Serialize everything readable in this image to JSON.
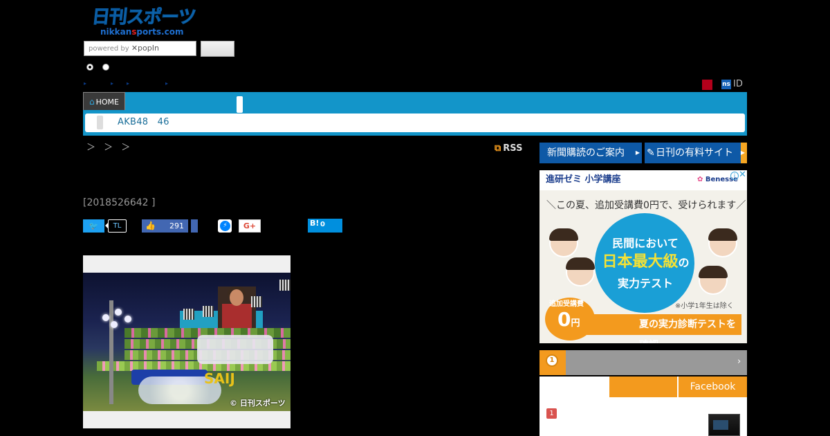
{
  "logo": {
    "jp": "日刊スポーツ",
    "en_pre": "nikkan",
    "en_s": "s",
    "en_post": "ports.com"
  },
  "search": {
    "powered_by": "powered by",
    "popin": "✕popIn",
    "button_label": ""
  },
  "nav": {
    "home": "HOME",
    "subnav_text": "AKB48　46"
  },
  "header_links": {
    "id_label": "ID",
    "ns_label": "ns"
  },
  "breadcrumb": "＞ ＞ ＞",
  "rss": "RSS",
  "article": {
    "date": "[2018526642 ]"
  },
  "share": {
    "twitter_label": "",
    "tl_label": "TL",
    "like_count": "291",
    "gplus_label": "G+",
    "hatena_label": "B!",
    "hatena_count": "0"
  },
  "photo": {
    "credit": "© 日刊スポーツ",
    "sign_text": "SAIJ"
  },
  "sidebar": {
    "subscribe_btn": "新聞購読のご案内",
    "paid_btn": "日刊の有料サイト",
    "ad": {
      "title": "進研ゼミ 小学講座",
      "brand": "Benesse",
      "slogan": "＼この夏、追加受講費0円で、受けられます／",
      "circle_l1": "民間において",
      "circle_l2": "日本最大級",
      "circle_l2_suffix": "の",
      "circle_l3": "実力テスト",
      "badge_small": "追加受講費",
      "badge_big": "0",
      "badge_unit": "円",
      "note": "※小学1年生は除く",
      "cta": "夏の実力診断テストを確認"
    },
    "ranking": {
      "medal": "1",
      "arrow": "›",
      "tab_facebook": "Facebook",
      "first_rank": "1"
    }
  },
  "colors": {
    "nav_blue": "#1395c9",
    "orange": "#f39a1e",
    "dark_blue": "#0e59a6"
  }
}
